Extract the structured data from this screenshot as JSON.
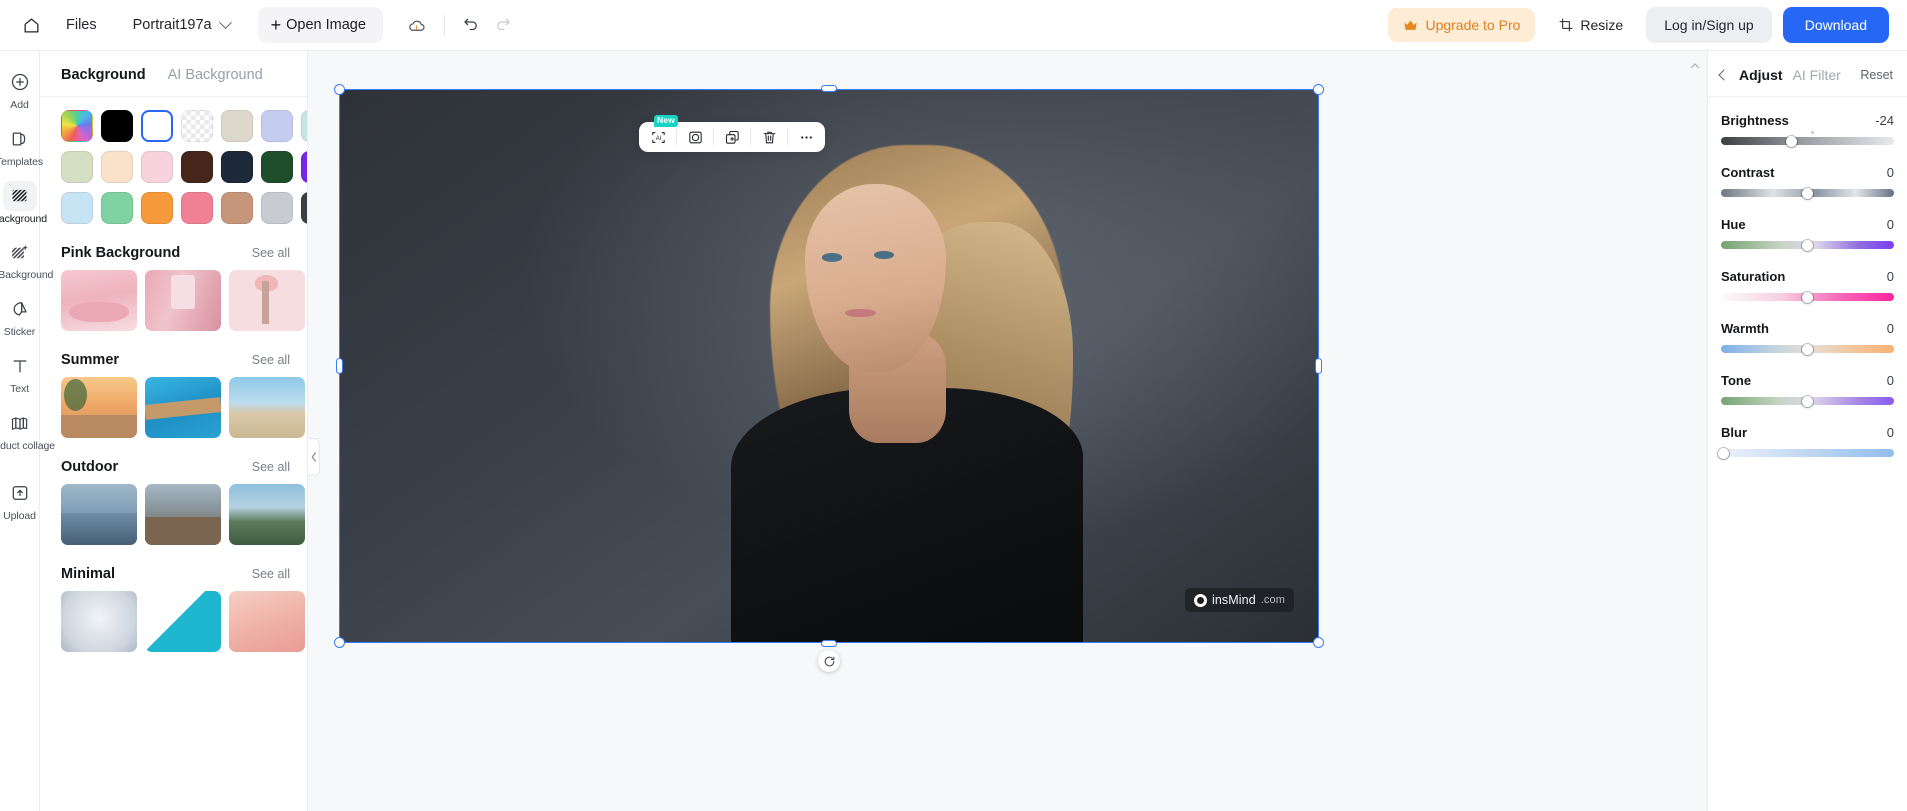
{
  "topbar": {
    "home_icon": "home-icon",
    "files_label": "Files",
    "document_name": "Portrait197a",
    "open_image_label": "Open Image",
    "open_image_plus": "+",
    "cloud_icon": "cloud-upload-icon",
    "undo_icon": "undo-icon",
    "redo_icon": "redo-icon",
    "upgrade_label": "Upgrade to Pro",
    "upgrade_icon": "crown-icon",
    "resize_label": "Resize",
    "resize_icon": "resize-icon",
    "login_label": "Log in/Sign up",
    "download_label": "Download",
    "accent_blue": "#2667f5",
    "upgrade_bg": "#fdecd6",
    "upgrade_fg": "#e08020"
  },
  "rail": {
    "items": [
      {
        "label": "Add",
        "icon": "plus-circle-icon",
        "active": false
      },
      {
        "label": "Templates",
        "icon": "templates-icon",
        "active": false
      },
      {
        "label": "Background",
        "icon": "background-icon",
        "active": true
      },
      {
        "label": "AI Background",
        "icon": "ai-background-icon",
        "active": false
      },
      {
        "label": "Sticker",
        "icon": "sticker-icon",
        "active": false
      },
      {
        "label": "Text",
        "icon": "text-icon",
        "active": false
      },
      {
        "label": "Product collage",
        "icon": "product-collage-icon",
        "active": false
      },
      {
        "label": "Upload",
        "icon": "upload-icon",
        "active": false
      }
    ]
  },
  "panel": {
    "tabs": [
      {
        "label": "Background",
        "active": true
      },
      {
        "label": "AI Background",
        "active": false
      }
    ],
    "swatches": [
      {
        "name": "rainbow",
        "color": "rainbow",
        "selected": false
      },
      {
        "name": "black",
        "color": "#000000",
        "selected": false
      },
      {
        "name": "white",
        "color": "#ffffff",
        "selected": true
      },
      {
        "name": "transparent",
        "color": "checker",
        "selected": false
      },
      {
        "name": "beige",
        "color": "#ddd8cb",
        "selected": false
      },
      {
        "name": "periwinkle",
        "color": "#c4cdf0",
        "selected": false
      },
      {
        "name": "mint",
        "color": "#c7e6e2",
        "selected": false
      },
      {
        "name": "sage",
        "color": "#d4dfc4",
        "selected": false
      },
      {
        "name": "cream",
        "color": "#fae2ca",
        "selected": false
      },
      {
        "name": "blush-pink",
        "color": "#f6d3dd",
        "selected": false
      },
      {
        "name": "dark-brown",
        "color": "#46261a",
        "selected": false
      },
      {
        "name": "navy",
        "color": "#1d2838",
        "selected": false
      },
      {
        "name": "forest-green",
        "color": "#1e4d2b",
        "selected": false
      },
      {
        "name": "violet",
        "color": "#7728e6",
        "selected": false
      },
      {
        "name": "pale-blue",
        "color": "#c7e3f4",
        "selected": false
      },
      {
        "name": "green",
        "color": "#7fd3a2",
        "selected": false
      },
      {
        "name": "orange",
        "color": "#f79a3c",
        "selected": false
      },
      {
        "name": "rose",
        "color": "#f08096",
        "selected": false
      },
      {
        "name": "tan",
        "color": "#c5967a",
        "selected": false
      },
      {
        "name": "light-gray",
        "color": "#c8cbd1",
        "selected": false
      },
      {
        "name": "charcoal",
        "color": "#3b3e44",
        "selected": false
      }
    ],
    "sections": [
      {
        "title": "Pink Background",
        "see_all": "See all",
        "thumbs": [
          "t-pink1",
          "t-pink2",
          "t-pink3"
        ]
      },
      {
        "title": "Summer",
        "see_all": "See all",
        "thumbs": [
          "t-sum1",
          "t-sum2",
          "t-sum3"
        ]
      },
      {
        "title": "Outdoor",
        "see_all": "See all",
        "thumbs": [
          "t-out1",
          "t-out2",
          "t-out3"
        ]
      },
      {
        "title": "Minimal",
        "see_all": "See all",
        "thumbs": [
          "t-min1",
          "t-min2",
          "t-min3"
        ]
      }
    ],
    "collapse_icon": "chevron-left-icon"
  },
  "canvas": {
    "object_toolbar": [
      {
        "name": "ai-edit-tool",
        "icon": "ai-bracket-icon",
        "badge": "New"
      },
      {
        "name": "shadow-tool",
        "icon": "circle-square-icon",
        "badge": ""
      },
      {
        "name": "duplicate-tool",
        "icon": "duplicate-icon",
        "badge": ""
      },
      {
        "name": "delete-tool",
        "icon": "trash-icon",
        "badge": ""
      },
      {
        "name": "more-tool",
        "icon": "more-horizontal-icon",
        "badge": ""
      }
    ],
    "watermark_text": "insMind",
    "watermark_suffix": ".com",
    "selection_color": "#3a7bf7",
    "rotate_icon": "rotate-icon"
  },
  "adjust": {
    "back_icon": "chevron-left-icon",
    "tabs": [
      {
        "label": "Adjust",
        "active": true
      },
      {
        "label": "AI Filter",
        "active": false
      }
    ],
    "reset_label": "Reset",
    "sliders": [
      {
        "name": "Brightness",
        "value": "-24",
        "pos": 45.5,
        "track": "tr-brightness",
        "tick": 50
      },
      {
        "name": "Contrast",
        "value": "0",
        "pos": 50,
        "track": "tr-contrast",
        "tick": null
      },
      {
        "name": "Hue",
        "value": "0",
        "pos": 50,
        "track": "tr-hue",
        "tick": null
      },
      {
        "name": "Saturation",
        "value": "0",
        "pos": 50,
        "track": "tr-saturation",
        "tick": null
      },
      {
        "name": "Warmth",
        "value": "0",
        "pos": 50,
        "track": "tr-warmth",
        "tick": null
      },
      {
        "name": "Tone",
        "value": "0",
        "pos": 50,
        "track": "tr-tone",
        "tick": null
      },
      {
        "name": "Blur",
        "value": "0",
        "pos": 1.5,
        "track": "tr-blur",
        "tick": null
      }
    ]
  }
}
